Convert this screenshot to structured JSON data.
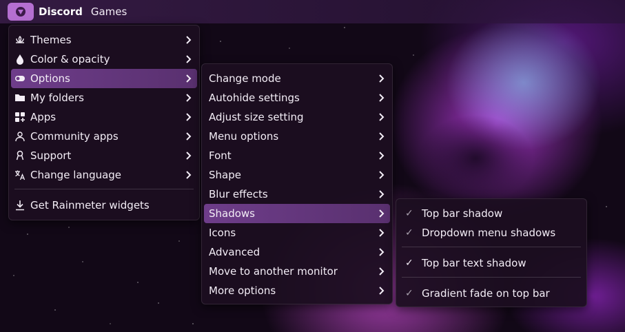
{
  "topbar": {
    "app_title": "Discord",
    "tab_games": "Games"
  },
  "main_menu": {
    "items": [
      {
        "label": "Themes",
        "icon": "lotus-icon"
      },
      {
        "label": "Color & opacity",
        "icon": "droplet-icon"
      },
      {
        "label": "Options",
        "icon": "toggle-icon"
      },
      {
        "label": "My folders",
        "icon": "folder-icon"
      },
      {
        "label": "Apps",
        "icon": "apps-grid-icon"
      },
      {
        "label": "Community apps",
        "icon": "person-icon"
      },
      {
        "label": "Support",
        "icon": "ribbon-icon"
      },
      {
        "label": "Change language",
        "icon": "translate-icon"
      }
    ],
    "footer": {
      "label": "Get Rainmeter widgets",
      "icon": "download-icon"
    }
  },
  "options_menu": {
    "items": [
      {
        "label": "Change mode"
      },
      {
        "label": "Autohide settings"
      },
      {
        "label": "Adjust size setting"
      },
      {
        "label": "Menu options"
      },
      {
        "label": "Font"
      },
      {
        "label": "Shape"
      },
      {
        "label": "Blur effects"
      },
      {
        "label": "Shadows"
      },
      {
        "label": "Icons"
      },
      {
        "label": "Advanced"
      },
      {
        "label": "Move to another monitor"
      },
      {
        "label": "More options"
      }
    ]
  },
  "shadows_menu": {
    "items": [
      {
        "label": "Top bar shadow",
        "checked": false
      },
      {
        "label": "Dropdown menu shadows",
        "checked": false
      },
      {
        "label": "Top bar text shadow",
        "checked": true
      },
      {
        "label": "Gradient fade on top bar",
        "checked": false
      }
    ],
    "check_glyph": "✓"
  },
  "colors": {
    "accent": "#6e3d8a",
    "logo_bg": "#b56fd1",
    "menu_bg": "#1c0e20"
  }
}
